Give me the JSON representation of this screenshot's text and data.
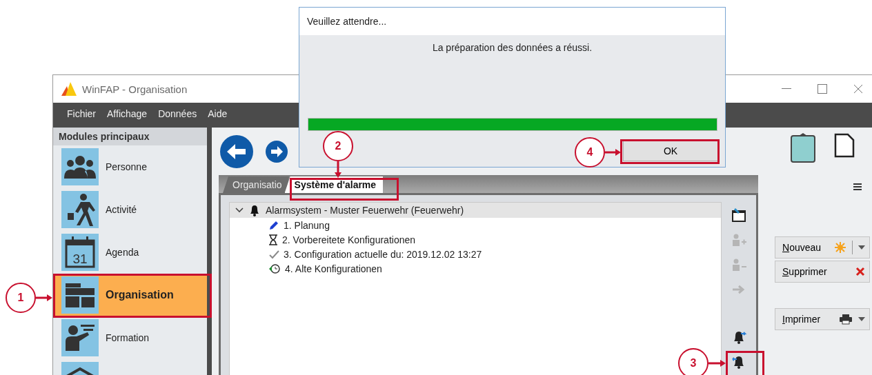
{
  "window": {
    "title": "WinFAP - Organisation"
  },
  "menu": [
    "Fichier",
    "Affichage",
    "Données",
    "Aide"
  ],
  "sidebar": {
    "header": "Modules principaux",
    "items": [
      {
        "label": "Personne",
        "selected": false
      },
      {
        "label": "Activité",
        "selected": false
      },
      {
        "label": "Agenda",
        "selected": false,
        "calendar_day": "31"
      },
      {
        "label": "Organisation",
        "selected": true
      },
      {
        "label": "Formation",
        "selected": false
      }
    ]
  },
  "tabs": [
    {
      "label": "Organisatio",
      "selected": false
    },
    {
      "label": "Système d'alarme",
      "selected": true
    }
  ],
  "tree": {
    "label": "Alarmsystem - Muster Feuerwehr (Feuerwehr)",
    "expanded": true,
    "children": [
      {
        "label": "1. Planung"
      },
      {
        "label": "2. Vorbereitete Konfigurationen"
      },
      {
        "label": "3. Configuration actuelle du: 2019.12.02 13:27"
      },
      {
        "label": "4. Alte Konfigurationen"
      }
    ]
  },
  "toolbar": [
    {
      "disabled": false
    },
    {
      "disabled": true
    },
    {
      "disabled": true
    },
    {
      "disabled": true
    },
    {
      "disabled": false
    },
    {
      "disabled": false
    }
  ],
  "actions": [
    {
      "label": "Nouveau",
      "kind": "split"
    },
    {
      "label": "Supprimer",
      "kind": "plain"
    },
    {
      "label": "Imprimer",
      "kind": "split"
    }
  ],
  "dialog": {
    "title": "Veuillez attendre...",
    "message": "La préparation des données a réussi.",
    "progress": {
      "level": 1
    },
    "button": "OK"
  },
  "annotations": [
    {
      "label": "1"
    },
    {
      "label": "2"
    },
    {
      "label": "3"
    },
    {
      "label": "4"
    }
  ]
}
